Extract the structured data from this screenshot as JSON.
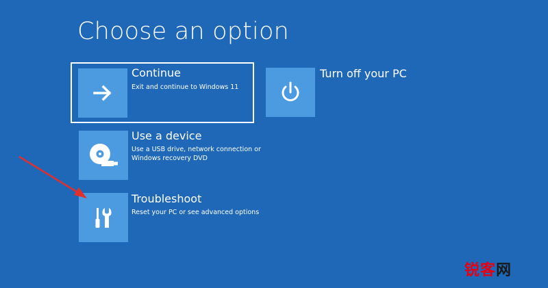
{
  "page": {
    "title": "Choose an option"
  },
  "options": [
    {
      "title": "Continue",
      "description": "Exit and continue to Windows 11",
      "icon": "arrow-right-icon"
    },
    {
      "title": "Turn off your PC",
      "description": "",
      "icon": "power-icon"
    },
    {
      "title": "Use a device",
      "description_line1": "Use a USB drive, network connection or",
      "description_line2": "Windows recovery DVD",
      "icon": "disc-usb-icon"
    },
    {
      "title": "Troubleshoot",
      "description": "Reset your PC or see advanced options",
      "icon": "tools-icon"
    }
  ],
  "watermark": {
    "part1": "锐客",
    "part2": "网"
  },
  "colors": {
    "background": "#1f68b8",
    "tile": "#4c9be0",
    "annotation_arrow": "#e0302e"
  }
}
